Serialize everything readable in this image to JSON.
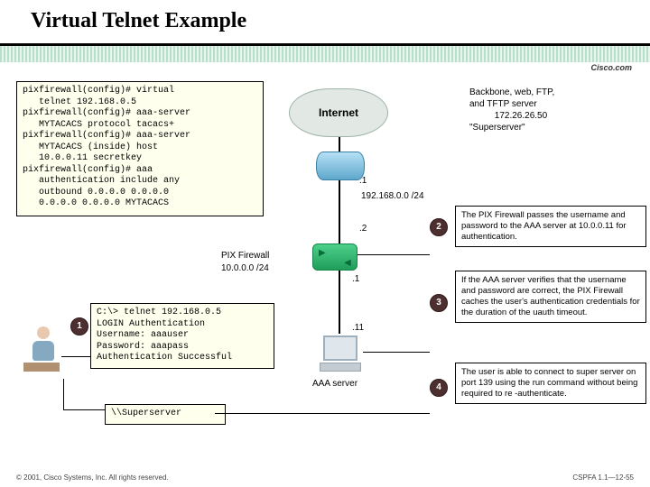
{
  "title": "Virtual Telnet Example",
  "brand": "Cisco.com",
  "config": "pixfirewall(config)# virtual\n   telnet 192.168.0.5\npixfirewall(config)# aaa-server\n   MYTACACS protocol tacacs+\npixfirewall(config)# aaa-server\n   MYTACACS (inside) host\n   10.0.0.11 secretkey\npixfirewall(config)# aaa\n   authentication include any\n   outbound 0.0.0.0 0.0.0.0\n   0.0.0.0 0.0.0.0 MYTACACS",
  "cloud": "Internet",
  "superserver_lines": "Backbone, web, FTP,\nand TFTP server\n          172.26.26.50\n\"Superserver\"",
  "pix_label": "PIX Firewall",
  "outside_net": "192.168.0.0 /24",
  "inside_net": "10.0.0.0 /24",
  "router_inside": ".1",
  "pix_outside": ".2",
  "pix_inside": ".1",
  "aaa_ip": ".11",
  "aaa_label": "AAA server",
  "telnet_box": "C:\\> telnet 192.168.0.5\nLOGIN Authentication\nUsername: aaauser\nPassword: aaapass\nAuthentication Successful",
  "super_cmd": "\\\\Superserver",
  "steps": {
    "s1": "1",
    "s2": "2",
    "s3": "3",
    "s4": "4"
  },
  "callouts": {
    "c2": "The PIX Firewall passes the username and password to the AAA server at 10.0.0.11 for authentication.",
    "c3": "If the AAA server verifies that the username and password are correct, the PIX Firewall caches the user's authentication credentials for the duration of the uauth timeout.",
    "c4": "The user is able to connect to super server on port 139 using the run command without being required to re -authenticate."
  },
  "footer_left": "© 2001, Cisco Systems, Inc. All rights reserved.",
  "footer_right": "CSPFA 1.1—12-55"
}
